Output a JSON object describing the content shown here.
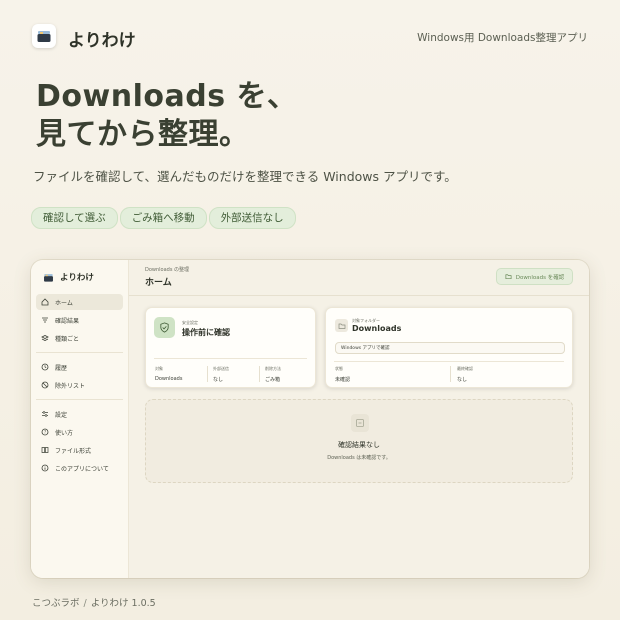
{
  "header": {
    "brand": "よりわけ",
    "tagline": "Windows用 Downloads整理アプリ"
  },
  "hero": {
    "title_line1": "Downloads を、",
    "title_line2": "見てから整理。",
    "subtitle": "ファイルを確認して、選んだものだけを整理できる Windows アプリです。"
  },
  "chips": [
    "確認して選ぶ",
    "ごみ箱へ移動",
    "外部送信なし"
  ],
  "app": {
    "brand": "よりわけ",
    "nav": {
      "home": "ホーム",
      "results": "確認結果",
      "types": "種類ごと",
      "history": "履歴",
      "exclude": "除外リスト",
      "settings": "設定",
      "howto": "使い方",
      "formats": "ファイル形式",
      "about": "このアプリについて"
    },
    "main": {
      "eyebrow": "Downloads の整理",
      "title": "ホーム",
      "primary_button": "Downloads を確認"
    },
    "card_safety": {
      "eyebrow": "安全設定",
      "title": "操作前に確認",
      "stats": [
        {
          "label": "対象",
          "value": "Downloads"
        },
        {
          "label": "外部送信",
          "value": "なし"
        },
        {
          "label": "削除方法",
          "value": "ごみ箱"
        }
      ]
    },
    "card_folder": {
      "eyebrow": "対象フォルダー",
      "title": "Downloads",
      "path": "Windows アプリで確認",
      "stats": [
        {
          "label": "状態",
          "value": "未確認"
        },
        {
          "label": "最終確認",
          "value": "なし"
        }
      ]
    },
    "empty": {
      "title": "確認結果なし",
      "subtitle": "Downloads は未確認です。"
    }
  },
  "footer": {
    "maker": "こつぶラボ",
    "product_version": "よりわけ 1.0.5"
  },
  "colors": {
    "background": "#f5f0e4",
    "accent_green": "#e3eedb",
    "text": "#2f3329"
  }
}
